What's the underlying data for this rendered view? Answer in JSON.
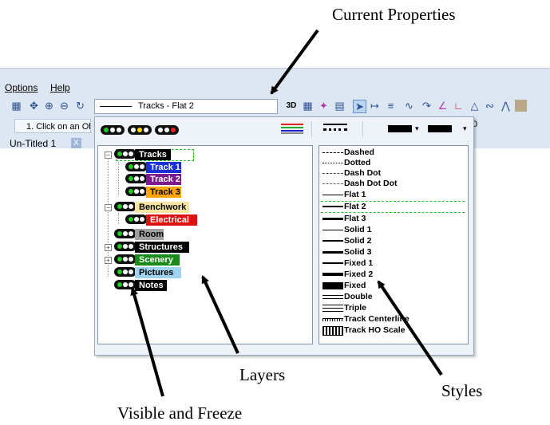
{
  "annotations": {
    "current_properties": "Current Properties",
    "layers": "Layers",
    "styles": "Styles",
    "visible_freeze": "Visible and Freeze"
  },
  "menubar": {
    "options": "Options",
    "help": "Help"
  },
  "toolbar": {
    "current_style_value": "Tracks - Flat 2",
    "btn_3d": "3D"
  },
  "status": {
    "instruction": "1. Click on an Ob"
  },
  "document_tab": {
    "title": "Un-Titled 1",
    "close": "X"
  },
  "panel_fragment": "0",
  "layers": [
    {
      "name": "Tracks",
      "bg": "#000000",
      "fg": "#ffffff"
    },
    {
      "name": "Track 1",
      "bg": "#1a2fd6",
      "fg": "#ffffff"
    },
    {
      "name": "Track 2",
      "bg": "#7a1a8c",
      "fg": "#ffffff"
    },
    {
      "name": "Track 3",
      "bg": "#ffa500",
      "fg": "#000000"
    },
    {
      "name": "Benchwork",
      "bg": "#f5e5a0",
      "fg": "#000000"
    },
    {
      "name": "Electrical",
      "bg": "#e01010",
      "fg": "#ffffff"
    },
    {
      "name": "Room",
      "bg": "#a0a0a0",
      "fg": "#000000"
    },
    {
      "name": "Structures",
      "bg": "#000000",
      "fg": "#ffffff"
    },
    {
      "name": "Scenery",
      "bg": "#1a8a1a",
      "fg": "#ffffff"
    },
    {
      "name": "Pictures",
      "bg": "#9fd3ef",
      "fg": "#000000"
    },
    {
      "name": "Notes",
      "bg": "#000000",
      "fg": "#ffffff"
    }
  ],
  "styles": [
    {
      "name": "Dashed"
    },
    {
      "name": "Dotted"
    },
    {
      "name": "Dash Dot"
    },
    {
      "name": "Dash Dot Dot"
    },
    {
      "name": "Flat 1"
    },
    {
      "name": "Flat 2",
      "selected": true
    },
    {
      "name": "Flat 3"
    },
    {
      "name": "Solid 1"
    },
    {
      "name": "Solid 2"
    },
    {
      "name": "Solid 3"
    },
    {
      "name": "Fixed 1"
    },
    {
      "name": "Fixed 2"
    },
    {
      "name": "Fixed"
    },
    {
      "name": "Double"
    },
    {
      "name": "Triple"
    },
    {
      "name": "Track Centerline"
    },
    {
      "name": "Track HO Scale"
    }
  ],
  "colors": {
    "chrome_bg": "#dde7f3",
    "panel_bg": "#eef3f9",
    "selection_dash": "#22c422",
    "lamp_green": "#22cc22",
    "lamp_yellow": "#ffdd00",
    "lamp_red": "#ee2222"
  }
}
